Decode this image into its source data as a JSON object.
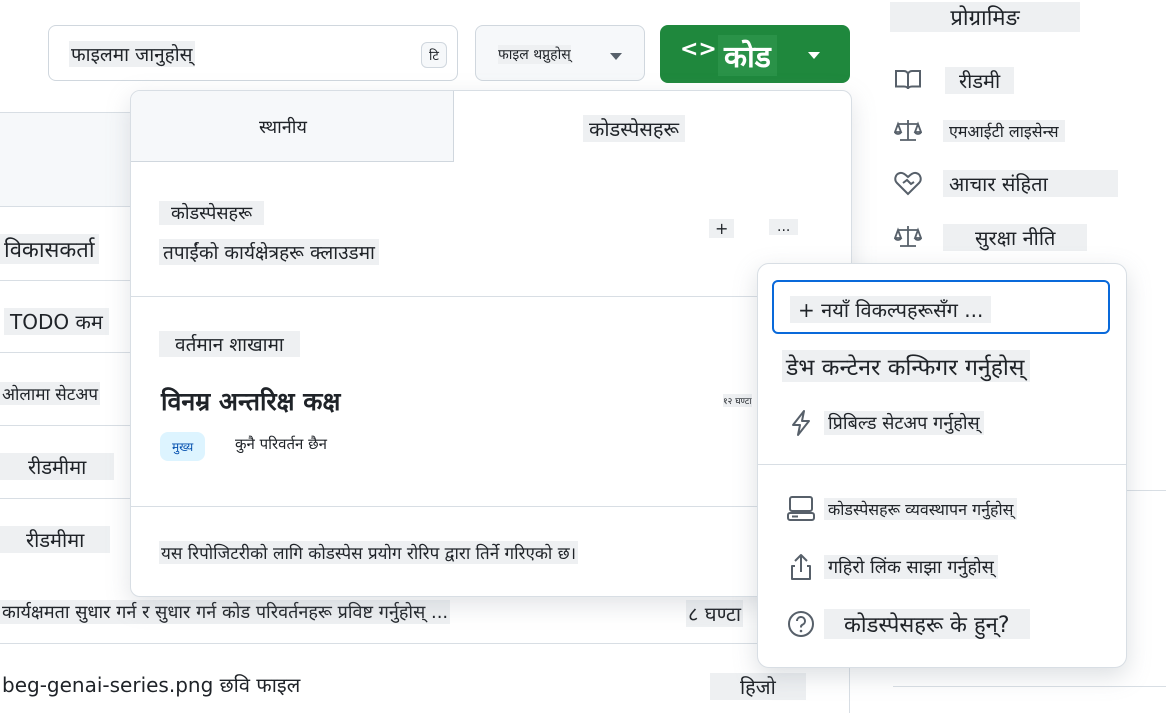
{
  "search": {
    "placeholder": "फाइलमा जानुहोस्",
    "shortcut": "टि"
  },
  "add_file": {
    "label": "फाइल थप्नुहोस्"
  },
  "code_button": {
    "icon": "<>",
    "label": "कोड"
  },
  "sidebar": {
    "title": "प्रोग्रामिङ",
    "items": [
      {
        "icon": "book-icon",
        "label": "रीडमी"
      },
      {
        "icon": "scale-icon",
        "label": "एमआईटी लाइसेन्स"
      },
      {
        "icon": "heart-handshake-icon",
        "label": "आचार संहिता"
      },
      {
        "icon": "scale-icon",
        "label": "सुरक्षा नीति"
      }
    ]
  },
  "file_list": {
    "fragments": [
      "विकासकर्ता",
      "TODO कम",
      "ओलामा सेटअप",
      "रीडमीमा",
      "रीडमीमा"
    ],
    "last_commit": {
      "message": "कार्यक्षमता सुधार गर्न र सुधार गर्न कोड परिवर्तनहरू प्रविष्ट गर्नुहोस् ...",
      "time": "८ घण्टा"
    },
    "file_row": {
      "name": "beg-genai-series.png छवि फाइल",
      "time": "हिजो"
    }
  },
  "codespaces_popup": {
    "tabs": [
      "स्थानीय",
      "कोडस्पेसहरू"
    ],
    "header": {
      "title": "कोडस्पेसहरू",
      "subtitle": "तपाईंको कार्यक्षेत्रहरू क्लाउडमा",
      "add": "+",
      "more": "..."
    },
    "branch_section": {
      "title": "वर्तमान शाखामा",
      "codespace_name": "विनम्र अन्तरिक्ष कक्ष",
      "time": "१२ घण्टा",
      "branch_badge": "मुख्य",
      "status": "कुनै परिवर्तन छैन"
    },
    "footer": "यस रिपोजिटरीको लागि कोडस्पेस प्रयोग रोरिप द्वारा तिर्ने गरिएको छ।"
  },
  "options_menu": {
    "new_with_options": "+ नयाँ विकल्पहरूसँग ...",
    "configure_dev_container": "डेभ कन्टेनर कन्फिगर गर्नुहोस्",
    "prebuild": {
      "icon": "lightning-icon",
      "label": "प्रिबिल्ड सेटअप गर्नुहोस्"
    },
    "manage": {
      "icon": "computer-icon",
      "label": "कोडस्पेसहरू व्यवस्थापन गर्नुहोस्"
    },
    "share": {
      "icon": "share-icon",
      "label": "गहिरो लिंक साझा गर्नुहोस्"
    },
    "what_are": {
      "icon": "question-icon",
      "label": "कोडस्पेसहरू के हुन्?"
    }
  }
}
